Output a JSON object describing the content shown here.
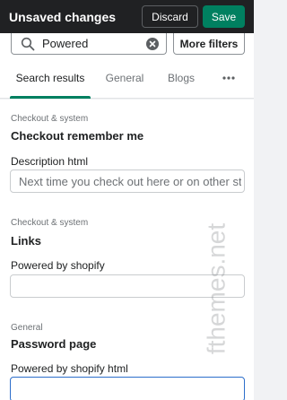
{
  "topbar": {
    "title": "Unsaved changes",
    "discard_label": "Discard",
    "save_label": "Save"
  },
  "search": {
    "value": "Powered",
    "more_filters_label": "More filters"
  },
  "tabs": [
    {
      "label": "Search results",
      "active": true
    },
    {
      "label": "General",
      "active": false
    },
    {
      "label": "Blogs",
      "active": false
    }
  ],
  "sections": [
    {
      "category": "Checkout & system",
      "title": "Checkout remember me",
      "field_label": "Description html",
      "field_value": "Next time you check out here or on other stores"
    },
    {
      "category": "Checkout & system",
      "title": "Links",
      "field_label": "Powered by shopify",
      "field_value": ""
    },
    {
      "category": "General",
      "title": "Password page",
      "field_label": "Powered by shopify html",
      "field_value": ""
    }
  ],
  "watermark": "fthemes.net",
  "icons": {
    "search": "search-icon",
    "clear": "clear-circle-icon",
    "more": "more-horizontal-icon"
  },
  "colors": {
    "topbar": "#202123",
    "save": "#008060",
    "focus": "#2c6ecb"
  }
}
